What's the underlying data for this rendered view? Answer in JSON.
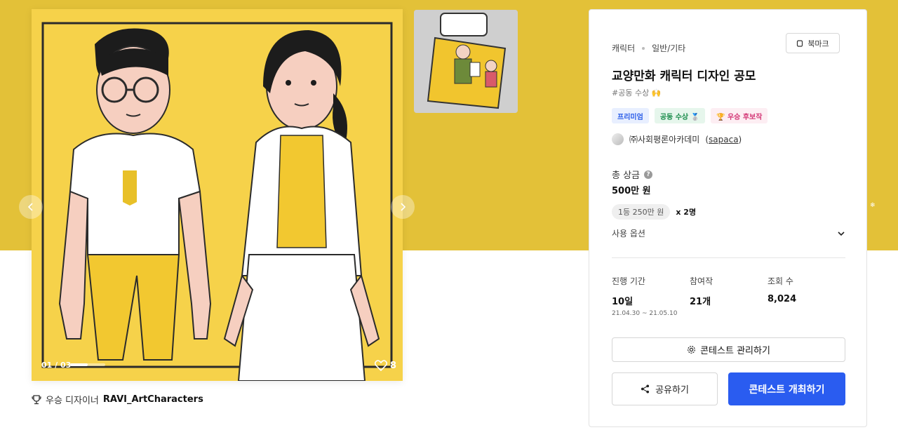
{
  "gallery": {
    "image_counter": "01 / 03",
    "progress": 0.5,
    "like_count": "8",
    "designer_prefix": "우승 디자이너",
    "designer_name": "RAVI_ArtCharacters"
  },
  "contest": {
    "category": "캐릭터",
    "subcategory": "일반/기타",
    "bookmark_label": "북마크",
    "title": "교양만화 캐릭터 디자인 공모",
    "hashtag": "#공동 수상 🙌",
    "badges": [
      {
        "label": "프리미엄"
      },
      {
        "label": "공동 수상 🥈"
      },
      {
        "label": "🏆 우승 후보작"
      }
    ],
    "host_name": "㈜사회평론아카데미",
    "host_handle": "sapaca",
    "prize_label": "총 상금",
    "prize_help": "?",
    "prize_total": "500만 원",
    "prize_tier": "1등 250만 원",
    "prize_tier_count": "x 2명",
    "options_label": "사용 옵션",
    "stats": {
      "period_label": "진행 기간",
      "period_value": "10일",
      "period_range": "21.04.30 ~ 21.05.10",
      "entries_label": "참여작",
      "entries_value": "21개",
      "views_label": "조회 수",
      "views_value": "8,024"
    },
    "manage_label": "콘테스트 관리하기",
    "share_label": "공유하기",
    "host_contest_label": "콘테스트 개최하기"
  },
  "colors": {
    "hero_band": "#e3c138",
    "image_bg": "#f6d24a",
    "primary_button": "#2a5cf0"
  }
}
